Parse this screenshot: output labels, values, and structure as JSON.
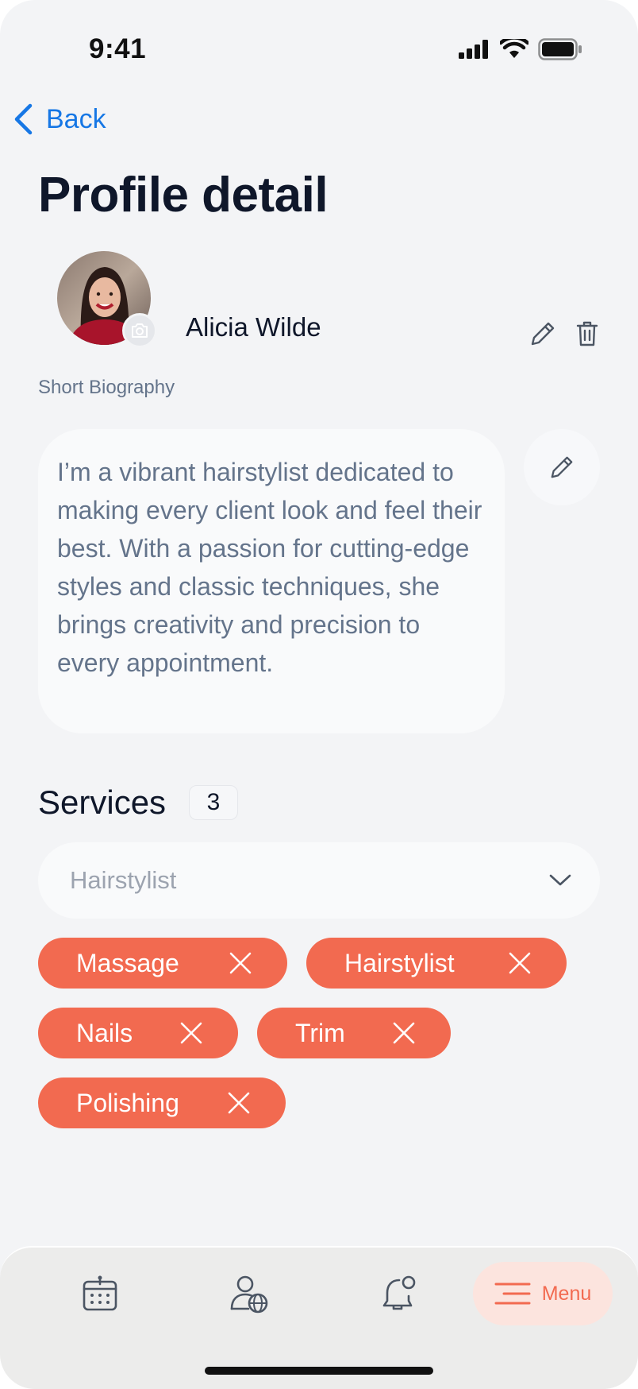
{
  "status_bar": {
    "time": "9:41"
  },
  "nav": {
    "back_label": "Back"
  },
  "page": {
    "title": "Profile detail"
  },
  "profile": {
    "name": "Alicia Wilde",
    "bio_label": "Short Biography",
    "bio": "I’m a vibrant hairstylist dedicated to making every client look and feel their best. With a passion for cutting-edge styles and classic techniques, she brings creativity and precision to every appointment."
  },
  "services": {
    "title": "Services",
    "count": "3",
    "select_value": "Hairstylist",
    "chips": [
      "Massage",
      "Hairstylist",
      "Nails",
      "Trim",
      "Polishing"
    ]
  },
  "tabbar": {
    "menu_label": "Menu",
    "icons": [
      "calendar-icon",
      "user-globe-icon",
      "bell-notification-icon",
      "menu-icon"
    ]
  },
  "colors": {
    "accent": "#F26A50",
    "link": "#1677E5",
    "background": "#F3F4F6"
  }
}
